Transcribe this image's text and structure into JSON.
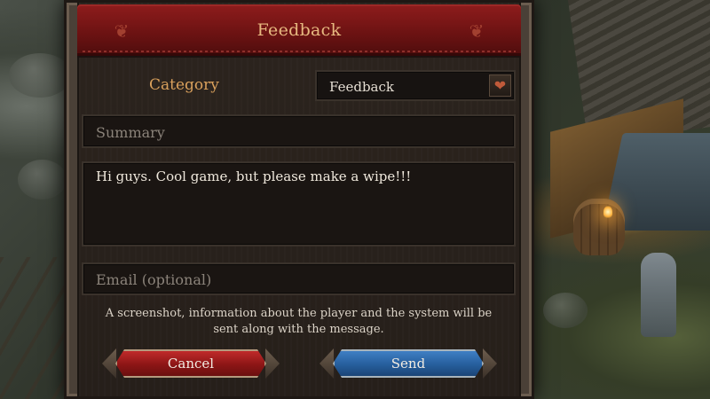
{
  "dialog": {
    "title": "Feedback",
    "category": {
      "label": "Category",
      "selected": "Feedback",
      "arrow_icon": "heart-chevron-down-icon"
    },
    "summary": {
      "placeholder": "Summary",
      "value": ""
    },
    "message": {
      "value": "Hi guys. Cool game, but please make a wipe!!!"
    },
    "email": {
      "placeholder": "Email (optional)",
      "value": ""
    },
    "note": {
      "line1": "A screenshot, information about the player and the system will be",
      "line2": "sent along with the message."
    },
    "buttons": {
      "cancel": "Cancel",
      "send": "Send"
    }
  },
  "colors": {
    "title_bar": "#8e1c1c",
    "title_text": "#e7b980",
    "label_text": "#d9a05c",
    "cancel_button": "#c02a2a",
    "send_button": "#3f7fc4"
  }
}
